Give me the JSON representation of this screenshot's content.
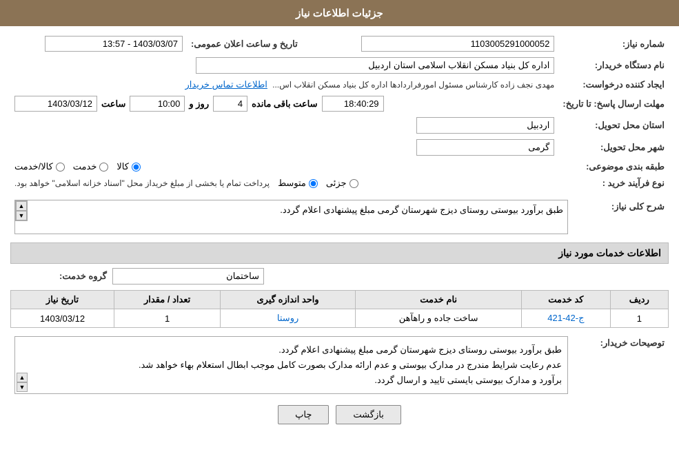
{
  "header": {
    "title": "جزئیات اطلاعات نیاز"
  },
  "fields": {
    "shomara_niaz_label": "شماره نیاز:",
    "shomara_niaz_value": "1103005291000052",
    "nam_dastgah_label": "نام دستگاه خریدار:",
    "nam_dastgah_value": "اداره کل بنیاد مسکن انقلاب اسلامی استان اردبیل",
    "ijad_konande_label": "ایجاد کننده درخواست:",
    "ijad_konande_value": "مهدی نجف زاده کارشناس مسئول امورفراردادها اداره کل بنیاد مسکن انقلاب اس...",
    "contact_link": "اطلاعات تماس خریدار",
    "mohlat_label": "مهلت ارسال پاسخ: تا تاریخ:",
    "mohlat_date": "1403/03/12",
    "mohlat_saat_label": "ساعت",
    "mohlat_saat_value": "10:00",
    "mohlat_roz_label": "روز و",
    "mohlat_roz_value": "4",
    "mohlat_remaining_label": "ساعت باقی مانده",
    "mohlat_remaining_value": "18:40:29",
    "tarikh_ilan_label": "تاریخ و ساعت اعلان عمومی:",
    "tarikh_ilan_value": "1403/03/07 - 13:57",
    "ostan_label": "استان محل تحویل:",
    "ostan_value": "اردبیل",
    "shahr_label": "شهر محل تحویل:",
    "shahr_value": "گرمی",
    "tabaqabandi_label": "طبقه بندی موضوعی:",
    "tabaqabandi_options": [
      "کالا",
      "خدمت",
      "کالا/خدمت"
    ],
    "tabaqabandi_selected": "کالا",
    "noeFarayand_label": "نوع فرآیند خرید :",
    "noeFarayand_options": [
      "جزئی",
      "متوسط"
    ],
    "noeFarayand_selected": "متوسط",
    "noeFarayand_note": "پرداخت تمام یا بخشی از مبلغ خریداز محل \"اسناد خزانه اسلامی\" خواهد بود.",
    "sharh_label": "شرح کلی نیاز:",
    "sharh_value": "طبق برآورد بیوستی روستای دیزج شهرستان گرمی مبلغ پیشنهادی اعلام گردد.",
    "khadamat_header": "اطلاعات خدمات مورد نیاز",
    "gorohe_khadamat_label": "گروه خدمت:",
    "gorohe_khadamat_value": "ساختمان",
    "table": {
      "headers": [
        "ردیف",
        "کد خدمت",
        "نام خدمت",
        "واحد اندازه گیری",
        "تعداد / مقدار",
        "تاریخ نیاز"
      ],
      "rows": [
        {
          "radif": "1",
          "code": "ج-42-421",
          "name": "ساخت جاده و راهآهن",
          "unit": "روستا",
          "count": "1",
          "date": "1403/03/12"
        }
      ]
    },
    "tawzih_label": "توصیحات خریدار:",
    "tawzih_value": "طبق برآورد بیوستی روستای دیزج شهرستان گرمی مبلغ پیشنهادی اعلام گردد.\nعدم رعایت شرایط مندرج در مدارک بیوستی و عدم ارائه مدارک بصورت کامل موجب ابطال استعلام بهاء خواهد شد.\nبرآورد و مدارک بیوستی بایستی تایید و ارسال گردد.",
    "buttons": {
      "back": "بازگشت",
      "print": "چاپ"
    }
  }
}
